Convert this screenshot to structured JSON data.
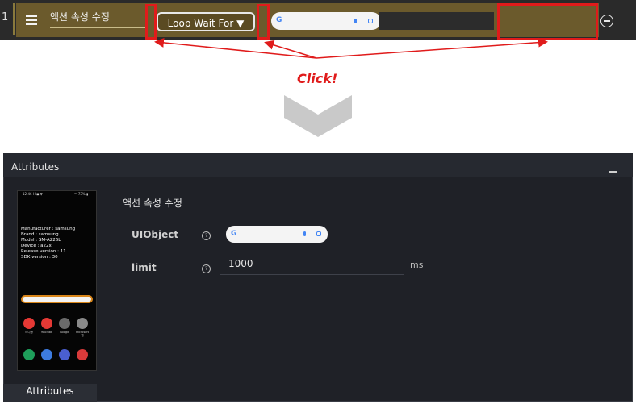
{
  "action_row": {
    "index": "1",
    "title": "액션 속성 수정",
    "loop_button_label": "Loop Wait For ▼"
  },
  "annotation": {
    "click_label": "Click!"
  },
  "attributes_panel": {
    "title": "Attributes",
    "tab_label": "Attributes",
    "section_title": "액션 속성 수정",
    "fields": {
      "uiobject_label": "UIObject",
      "limit_label": "limit",
      "limit_value": "1000",
      "limit_unit": "ms",
      "help_glyph": "?"
    },
    "device_preview": {
      "status_left": "12:46 H ◼ ▼",
      "status_right": "⁴ᴳ 73% ▮",
      "info_lines": [
        "Manufacturer : samsung",
        "Brand : samsung",
        "Model : SM-A226L",
        "Device : a22x",
        "Release version : 11",
        "SDK version : 30"
      ],
      "apps_row1": [
        "애니빵",
        "YouTube",
        "Google",
        "Microsoft 앱"
      ],
      "app_colors_row1": [
        "#e53935",
        "#e53935",
        "#6b6b6b",
        "#8a8a8a"
      ],
      "app_colors_row2": [
        "#1e9e5a",
        "#3d7be0",
        "#4a5fd1",
        "#d83a3a"
      ]
    }
  },
  "icons": {
    "menu": "hamburger-icon",
    "remove": "minus-circle-icon",
    "arrow": "chevron-down-arrow-icon",
    "google": "google-g-icon",
    "mic": "microphone-icon",
    "lens": "google-lens-icon",
    "help": "help-circle-icon",
    "minimize": "minimize-icon"
  },
  "colors": {
    "annotation_red": "#e01b1b",
    "row_bg": "#6b5a2c",
    "panel_bg": "#1f2127"
  }
}
